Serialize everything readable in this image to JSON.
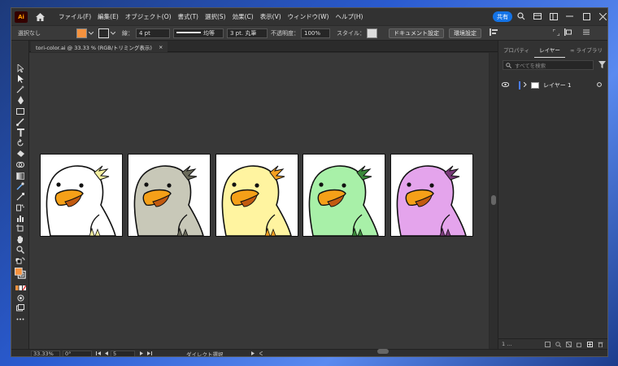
{
  "menubar": {
    "logo": "Ai",
    "items": [
      "ファイル(F)",
      "編集(E)",
      "オブジェクト(O)",
      "書式(T)",
      "選択(S)",
      "効果(C)",
      "表示(V)",
      "ウィンドウ(W)",
      "ヘルプ(H)"
    ],
    "share": "共有"
  },
  "control": {
    "selection": "選択なし",
    "stroke_label": "線：",
    "stroke_value": "4 pt",
    "stroke_style": "均等",
    "brush": "3 pt. 丸筆",
    "opacity_label": "不透明度：",
    "opacity_value": "100%",
    "style_label": "スタイル：",
    "doc_settings": "ドキュメント設定",
    "prefs": "環境設定",
    "fill_color": "#f5923e"
  },
  "document": {
    "tab_title": "tori-color.ai @ 33.33 % (RGB/トリミング表示)",
    "close": "×"
  },
  "artboards": [
    {
      "body": "#ffffff",
      "crest": "#f5f0a0"
    },
    {
      "body": "#c8c8b8",
      "crest": "#6a6a5a"
    },
    {
      "body": "#fff4a0",
      "crest": "#f5a020"
    },
    {
      "body": "#a8f0a8",
      "crest": "#3a8a3a"
    },
    {
      "body": "#e4a4ec",
      "crest": "#7a3a7a"
    }
  ],
  "beak_color": "#f5a018",
  "right_panel": {
    "tabs": [
      "プロパティ",
      "レイヤー",
      "ライブラリ"
    ],
    "search_placeholder": "すべてを検索",
    "layer_name": "レイヤー 1",
    "layer_count": "1 ..."
  },
  "status": {
    "zoom": "33.33%",
    "rotation": "0°",
    "artboard_number": "5",
    "tool": "ダイレクト選択"
  }
}
